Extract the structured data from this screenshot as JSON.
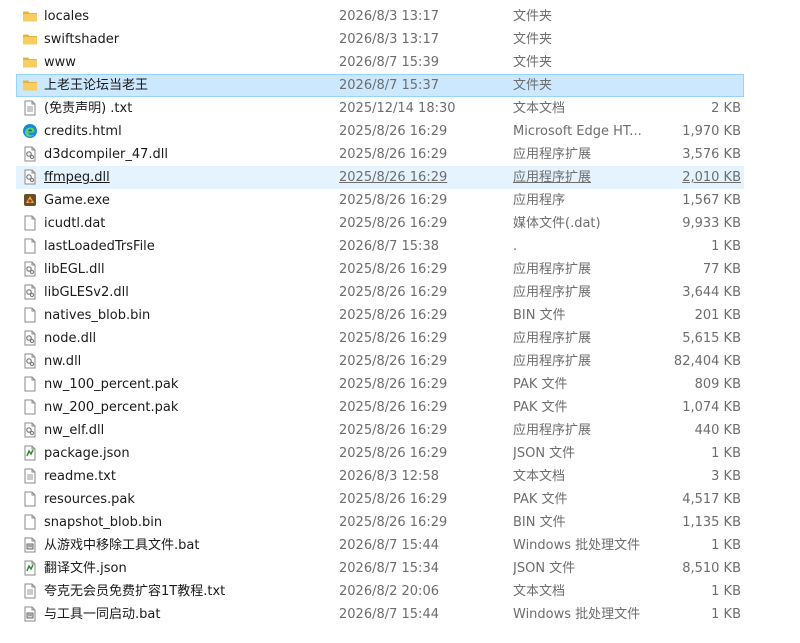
{
  "files": [
    {
      "name": "locales",
      "date": "2026/8/3 13:17",
      "type": "文件夹",
      "size": "",
      "icon": "folder-icon"
    },
    {
      "name": "swiftshader",
      "date": "2026/8/3 13:17",
      "type": "文件夹",
      "size": "",
      "icon": "folder-icon"
    },
    {
      "name": "www",
      "date": "2026/8/7 15:39",
      "type": "文件夹",
      "size": "",
      "icon": "folder-icon"
    },
    {
      "name": "上老王论坛当老王",
      "date": "2026/8/7 15:37",
      "type": "文件夹",
      "size": "",
      "icon": "folder-icon",
      "state": "selected"
    },
    {
      "name": "(免责声明) .txt",
      "date": "2025/12/14 18:30",
      "type": "文本文档",
      "size": "2 KB",
      "icon": "text-file-icon"
    },
    {
      "name": "credits.html",
      "date": "2025/8/26 16:29",
      "type": "Microsoft Edge HT...",
      "size": "1,970 KB",
      "icon": "edge-icon"
    },
    {
      "name": "d3dcompiler_47.dll",
      "date": "2025/8/26 16:29",
      "type": "应用程序扩展",
      "size": "3,576 KB",
      "icon": "dll-icon"
    },
    {
      "name": "ffmpeg.dll",
      "date": "2025/8/26 16:29",
      "type": "应用程序扩展",
      "size": "2,010 KB",
      "icon": "dll-icon",
      "state": "hover"
    },
    {
      "name": "Game.exe",
      "date": "2025/8/26 16:29",
      "type": "应用程序",
      "size": "1,567 KB",
      "icon": "game-exe-icon"
    },
    {
      "name": "icudtl.dat",
      "date": "2025/8/26 16:29",
      "type": "媒体文件(.dat)",
      "size": "9,933 KB",
      "icon": "blank-file-icon"
    },
    {
      "name": "lastLoadedTrsFile",
      "date": "2026/8/7 15:38",
      "type": ".",
      "size": "1 KB",
      "icon": "blank-file-icon"
    },
    {
      "name": "libEGL.dll",
      "date": "2025/8/26 16:29",
      "type": "应用程序扩展",
      "size": "77 KB",
      "icon": "dll-icon"
    },
    {
      "name": "libGLESv2.dll",
      "date": "2025/8/26 16:29",
      "type": "应用程序扩展",
      "size": "3,644 KB",
      "icon": "dll-icon"
    },
    {
      "name": "natives_blob.bin",
      "date": "2025/8/26 16:29",
      "type": "BIN 文件",
      "size": "201 KB",
      "icon": "blank-file-icon"
    },
    {
      "name": "node.dll",
      "date": "2025/8/26 16:29",
      "type": "应用程序扩展",
      "size": "5,615 KB",
      "icon": "dll-icon"
    },
    {
      "name": "nw.dll",
      "date": "2025/8/26 16:29",
      "type": "应用程序扩展",
      "size": "82,404 KB",
      "icon": "dll-icon"
    },
    {
      "name": "nw_100_percent.pak",
      "date": "2025/8/26 16:29",
      "type": "PAK 文件",
      "size": "809 KB",
      "icon": "blank-file-icon"
    },
    {
      "name": "nw_200_percent.pak",
      "date": "2025/8/26 16:29",
      "type": "PAK 文件",
      "size": "1,074 KB",
      "icon": "blank-file-icon"
    },
    {
      "name": "nw_elf.dll",
      "date": "2025/8/26 16:29",
      "type": "应用程序扩展",
      "size": "440 KB",
      "icon": "dll-icon"
    },
    {
      "name": "package.json",
      "date": "2025/8/26 16:29",
      "type": "JSON 文件",
      "size": "1 KB",
      "icon": "json-file-icon"
    },
    {
      "name": "readme.txt",
      "date": "2026/8/3 12:58",
      "type": "文本文档",
      "size": "3 KB",
      "icon": "text-file-icon"
    },
    {
      "name": "resources.pak",
      "date": "2025/8/26 16:29",
      "type": "PAK 文件",
      "size": "4,517 KB",
      "icon": "blank-file-icon"
    },
    {
      "name": "snapshot_blob.bin",
      "date": "2025/8/26 16:29",
      "type": "BIN 文件",
      "size": "1,135 KB",
      "icon": "blank-file-icon"
    },
    {
      "name": "从游戏中移除工具文件.bat",
      "date": "2026/8/7 15:44",
      "type": "Windows 批处理文件",
      "size": "1 KB",
      "icon": "batch-file-icon"
    },
    {
      "name": "翻译文件.json",
      "date": "2026/8/7 15:34",
      "type": "JSON 文件",
      "size": "8,510 KB",
      "icon": "json-file-icon"
    },
    {
      "name": "夸克无会员免费扩容1T教程.txt",
      "date": "2026/8/2 20:06",
      "type": "文本文档",
      "size": "1 KB",
      "icon": "text-file-icon"
    },
    {
      "name": "与工具一同启动.bat",
      "date": "2026/8/7 15:44",
      "type": "Windows 批处理文件",
      "size": "1 KB",
      "icon": "batch-file-icon"
    }
  ],
  "colors": {
    "selected_bg": "#cce8ff",
    "selected_border": "#99d1ff",
    "hover_bg": "#e5f3ff",
    "folder": "#f2c55c",
    "secondary_text": "#6d6d6d"
  }
}
